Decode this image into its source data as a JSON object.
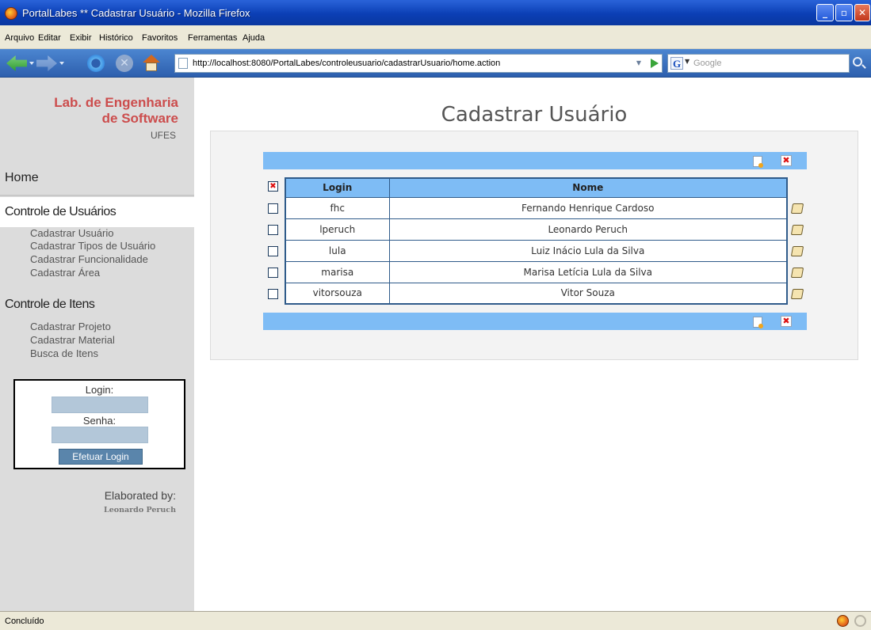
{
  "window": {
    "title": "PortalLabes ** Cadastrar Usuário - Mozilla Firefox",
    "min": "_",
    "max": "▫",
    "close": "✕"
  },
  "menu": [
    "Arquivo",
    "Editar",
    "Exibir",
    "Histórico",
    "Favoritos",
    "Ferramentas",
    "Ajuda"
  ],
  "browser": {
    "url": "http://localhost:8080/PortalLabes/controleusuario/cadastrarUsuario/home.action",
    "search_placeholder": "Google",
    "search_engine_icon": "G",
    "stop_icon": "✕"
  },
  "sidebar": {
    "brand_line1": "Lab. de Engenharia",
    "brand_line2": "de Software",
    "brand_sub": "UFES",
    "home": "Home",
    "section_users": {
      "title": "Controle de Usuários",
      "items": [
        "Cadastrar Usuário",
        "Cadastrar Tipos de Usuário",
        "Cadastrar Funcionalidade",
        "Cadastrar Área"
      ]
    },
    "section_items": {
      "title": "Controle de Itens",
      "items": [
        "Cadastrar Projeto",
        "Cadastrar Material",
        "Busca de Itens"
      ]
    },
    "login": {
      "login_label": "Login:",
      "password_label": "Senha:",
      "button": "Efetuar Login"
    },
    "elaborated_by": "Elaborated by:",
    "author": "Leonardo Peruch"
  },
  "main": {
    "title": "Cadastrar Usuário",
    "select_all_icon": "✖",
    "delete_icon": "✖",
    "table": {
      "headers": {
        "login": "Login",
        "nome": "Nome"
      },
      "rows": [
        {
          "login": "fhc",
          "nome": "Fernando Henrique Cardoso"
        },
        {
          "login": "lperuch",
          "nome": "Leonardo Peruch"
        },
        {
          "login": "lula",
          "nome": "Luiz Inácio Lula da Silva"
        },
        {
          "login": "marisa",
          "nome": "Marisa Letícia Lula da Silva"
        },
        {
          "login": "vitorsouza",
          "nome": "Vitor Souza"
        }
      ]
    }
  },
  "status": {
    "text": "Concluído"
  },
  "colors": {
    "header_blue": "#7ebcf5",
    "brand_red": "#cc4d4d",
    "border_blue": "#2f5b8a"
  }
}
